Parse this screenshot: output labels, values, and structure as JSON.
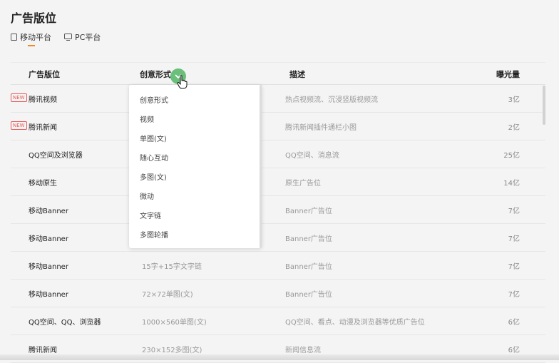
{
  "page": {
    "title": "广告版位"
  },
  "tabs": [
    {
      "label": "移动平台",
      "icon": "tablet-icon",
      "active": true
    },
    {
      "label": "PC平台",
      "icon": "monitor-icon",
      "active": false
    }
  ],
  "table": {
    "headers": {
      "position": "广告版位",
      "format": "创意形式",
      "description": "描述",
      "impressions": "曝光量"
    },
    "rows": [
      {
        "badge": "NEW",
        "name": "腾讯视频",
        "format": "",
        "description": "热点视频流、沉浸竖版视频流",
        "impressions": "3亿"
      },
      {
        "badge": "NEW",
        "name": "腾讯新闻",
        "format": "",
        "description": "腾讯新闻插件通栏小图",
        "impressions": "2亿"
      },
      {
        "badge": "",
        "name": "QQ空间及浏览器",
        "format": "",
        "description": "QQ空间、消息流",
        "impressions": "25亿"
      },
      {
        "badge": "",
        "name": "移动原生",
        "format": "",
        "description": "原生广告位",
        "impressions": "14亿"
      },
      {
        "badge": "",
        "name": "移动Banner",
        "format": "",
        "description": "Banner广告位",
        "impressions": "7亿"
      },
      {
        "badge": "",
        "name": "移动Banner",
        "format": "",
        "description": "Banner广告位",
        "impressions": "7亿"
      },
      {
        "badge": "",
        "name": "移动Banner",
        "format": "15字+15字文字链",
        "description": "Banner广告位",
        "impressions": "7亿"
      },
      {
        "badge": "",
        "name": "移动Banner",
        "format": "72×72单图(文)",
        "description": "Banner广告位",
        "impressions": "7亿"
      },
      {
        "badge": "",
        "name": "QQ空间、QQ、浏览器",
        "format": "1000×560单图(文)",
        "description": "QQ空间、看点、动漫及浏览器等优质广告位",
        "impressions": "6亿"
      },
      {
        "badge": "",
        "name": "腾讯新闻",
        "format": "230×152多图(文)",
        "description": "新闻信息流",
        "impressions": "6亿"
      }
    ]
  },
  "filter": {
    "icon": "chevron-down-icon",
    "color": "#6abf7b",
    "options": [
      "创意形式",
      "视频",
      "单图(文)",
      "随心互动",
      "多图(文)",
      "微动",
      "文字链",
      "多图轮播"
    ]
  },
  "colors": {
    "accent": "#f08a24",
    "new_badge": "#e85a5a"
  }
}
